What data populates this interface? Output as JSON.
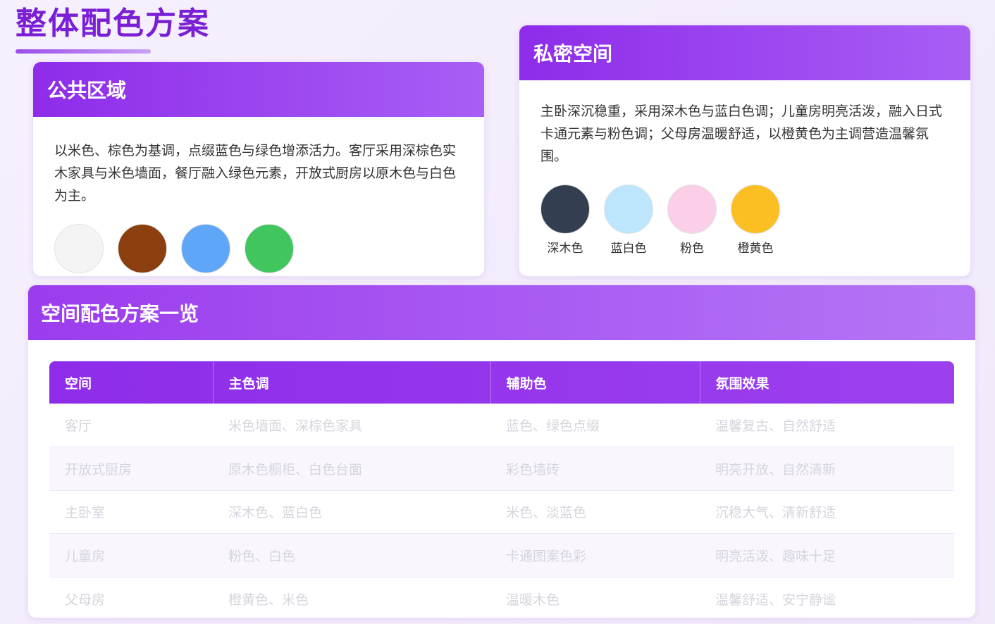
{
  "title": "整体配色方案",
  "public_area": {
    "heading": "公共区域",
    "description": "以米色、棕色为基调，点缀蓝色与绿色增添活力。客厅采用深棕色实木家具与米色墙面，餐厅融入绿色元素，开放式厨房以原木色与白色为主。",
    "swatches": [
      {
        "color": "#f4f4f4"
      },
      {
        "color": "#8b3e0e"
      },
      {
        "color": "#5fa5f8"
      },
      {
        "color": "#41c55f"
      }
    ]
  },
  "private_area": {
    "heading": "私密空间",
    "description": "主卧深沉稳重，采用深木色与蓝白色调；儿童房明亮活泼，融入日式卡通元素与粉色调；父母房温暖舒适，以橙黄色为主调营造温馨氛围。",
    "swatches": [
      {
        "color": "#333f51",
        "label": "深木色"
      },
      {
        "color": "#bde6fc",
        "label": "蓝白色"
      },
      {
        "color": "#fbcfe8",
        "label": "粉色"
      },
      {
        "color": "#fbbf24",
        "label": "橙黄色"
      }
    ]
  },
  "overview": {
    "heading": "空间配色方案一览",
    "columns": [
      "空间",
      "主色调",
      "辅助色",
      "氛围效果"
    ],
    "rows": [
      [
        "客厅",
        "米色墙面、深棕色家具",
        "蓝色、绿色点缀",
        "温馨复古、自然舒适"
      ],
      [
        "开放式厨房",
        "原木色橱柜、白色台面",
        "彩色墙砖",
        "明亮开放、自然清新"
      ],
      [
        "主卧室",
        "深木色、蓝白色",
        "米色、淡蓝色",
        "沉稳大气、清新舒适"
      ],
      [
        "儿童房",
        "粉色、白色",
        "卡通图案色彩",
        "明亮活泼、趣味十足"
      ],
      [
        "父母房",
        "橙黄色、米色",
        "温暖木色",
        "温馨舒适、安宁静谧"
      ]
    ]
  },
  "colors": {
    "accent": "#7a1fd6",
    "header_start": "#8e2cea",
    "header_end": "#a85ef5"
  }
}
